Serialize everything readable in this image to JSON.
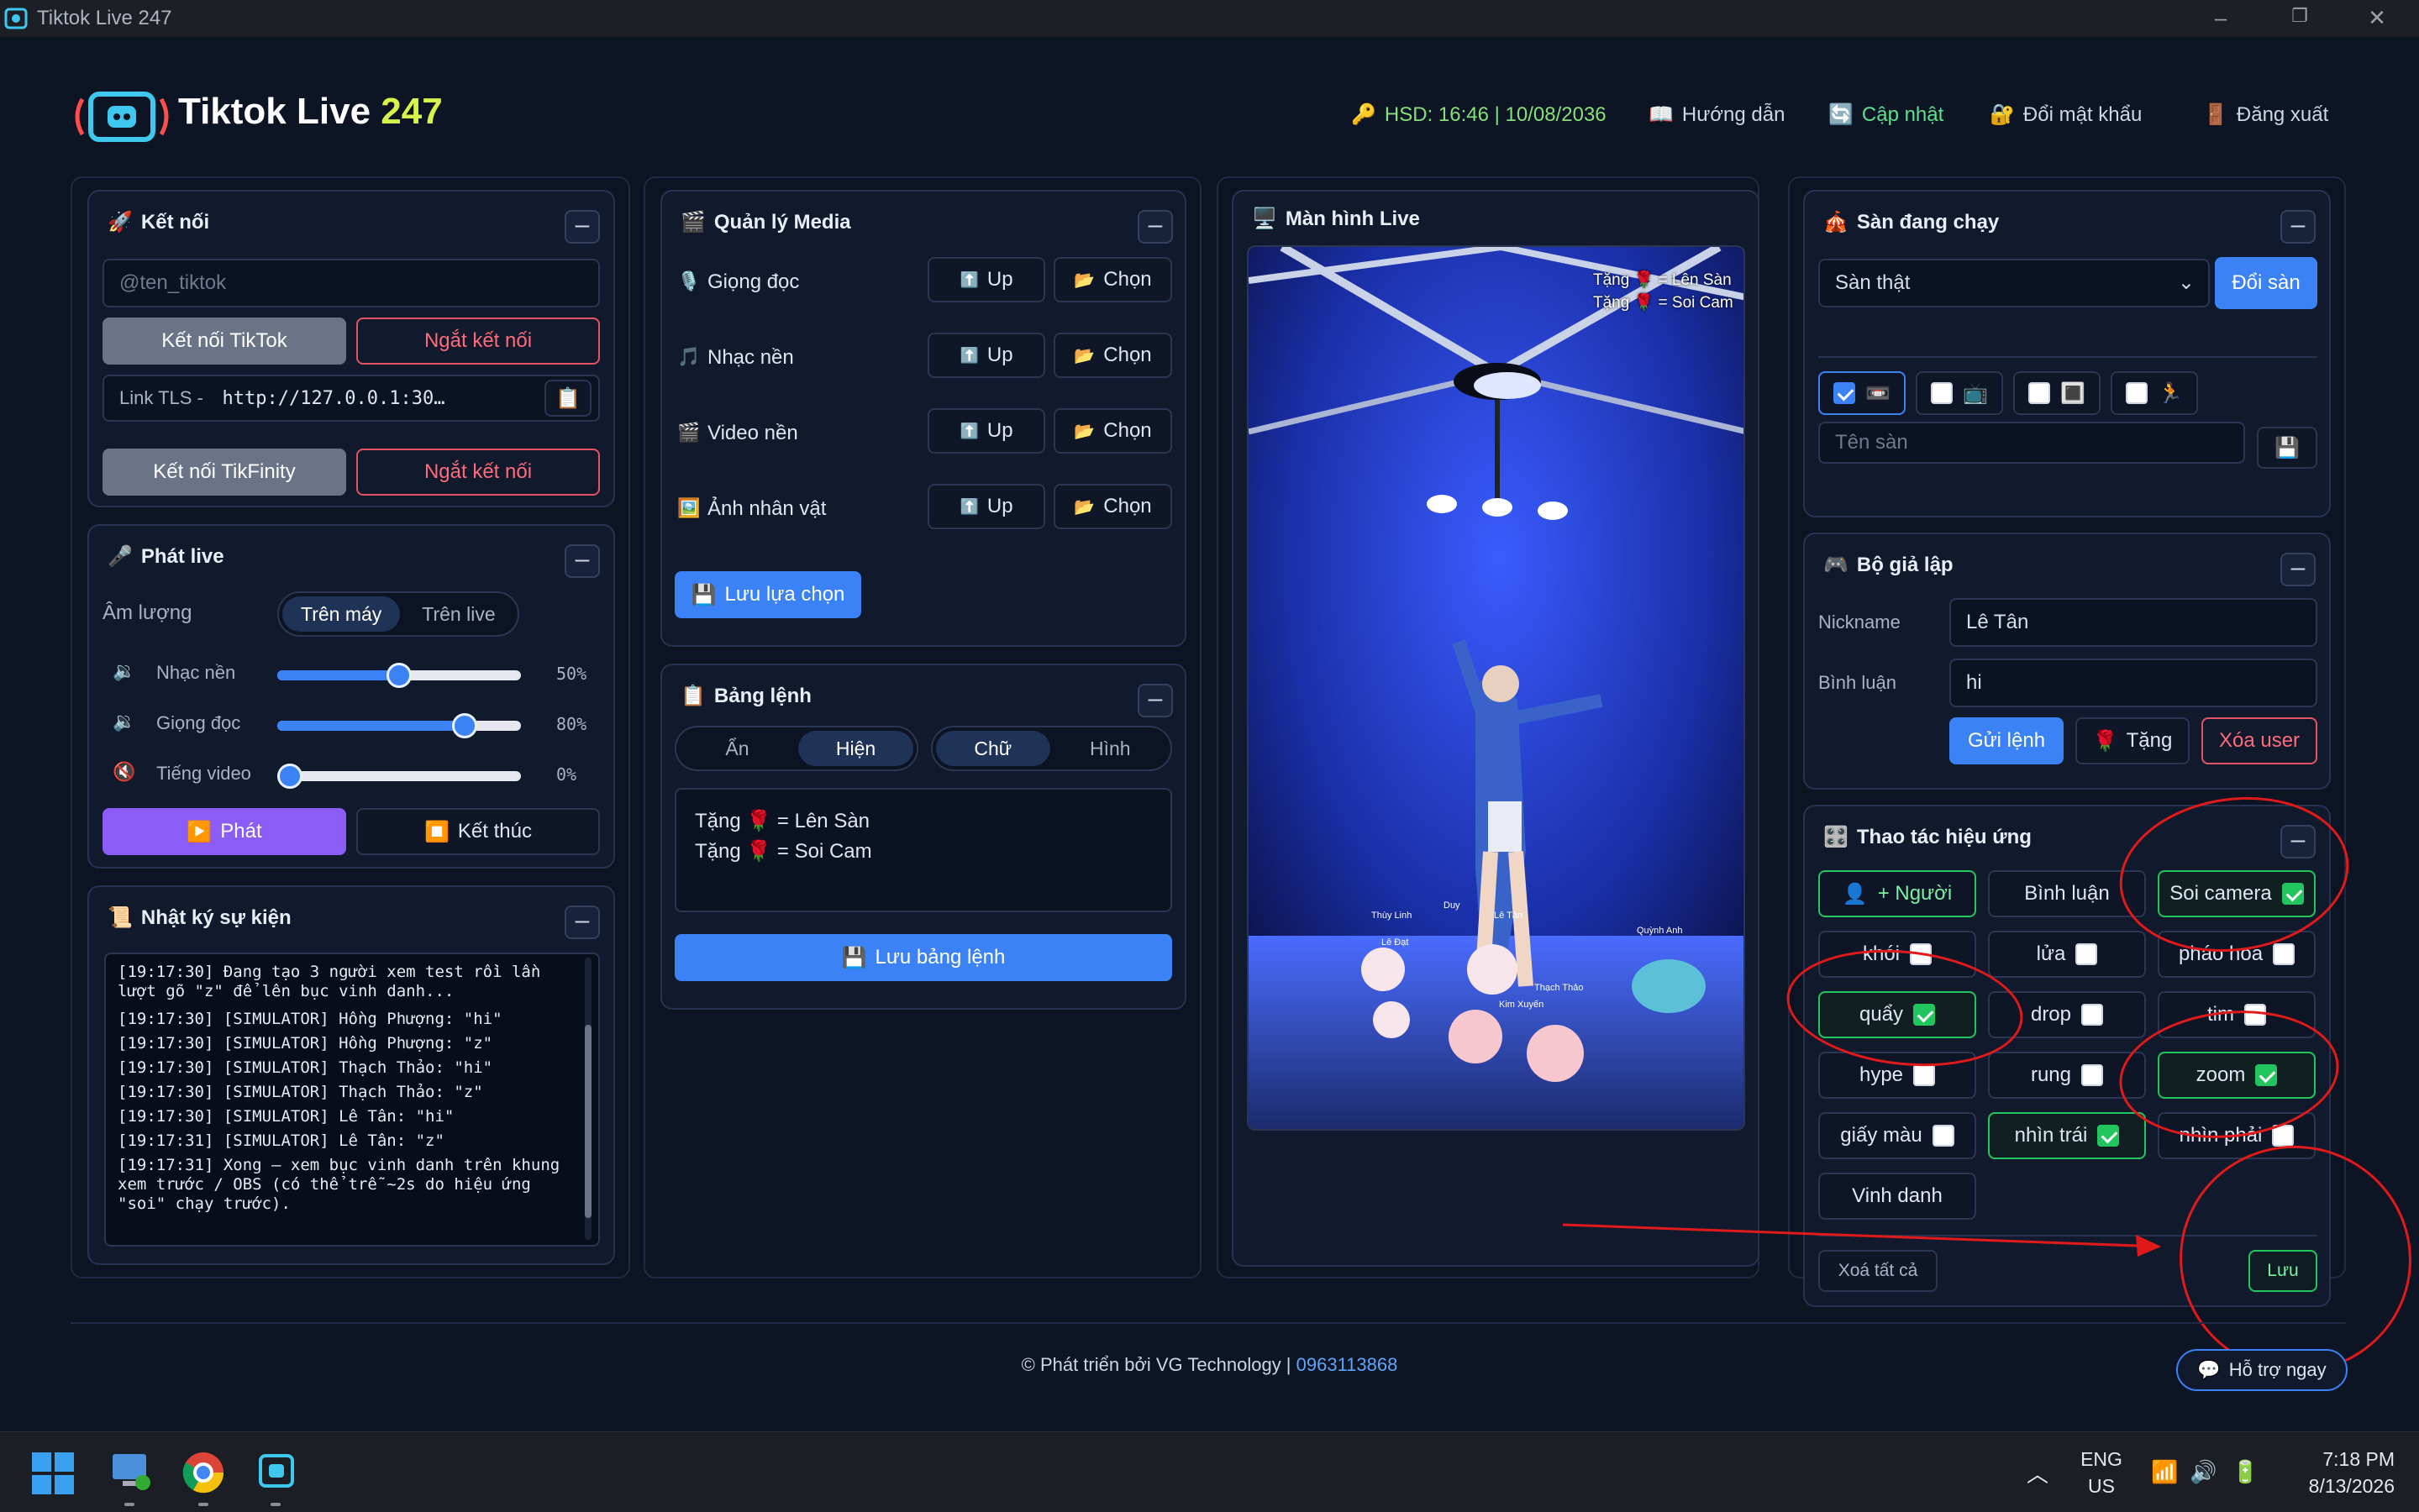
{
  "window": {
    "title": "Tiktok Live 247"
  },
  "brand": {
    "name": "Tiktok Live ",
    "accent": "247"
  },
  "header": {
    "hsd": "HSD: 16:46 | 10/08/2036",
    "guide": "Hướng dẫn",
    "update": "Cập nhật",
    "change_password": "Đổi mật khẩu",
    "logout": "Đăng xuất"
  },
  "connect": {
    "title": "Kết nối",
    "username_placeholder": "@ten_tiktok",
    "connect_tiktok": "Kết nối TikTok",
    "disconnect": "Ngắt kết nối",
    "link_label": "Link TLS -",
    "link_value": "http://127.0.0.1:30…",
    "connect_tikfinity": "Kết nối TikFinity",
    "disconnect2": "Ngắt kết nối"
  },
  "broadcast": {
    "title": "Phát live",
    "volume_label": "Âm lượng",
    "seg_machine": "Trên máy",
    "seg_live": "Trên live",
    "sliders": [
      {
        "label": "Nhạc nền",
        "value": 50,
        "text": "50%"
      },
      {
        "label": "Giọng đọc",
        "value": 80,
        "text": "80%"
      },
      {
        "label": "Tiếng video",
        "value": 0,
        "text": "0%"
      }
    ],
    "play": "Phát",
    "stop": "Kết thúc"
  },
  "log": {
    "title": "Nhật ký sự kiện",
    "lines": [
      "[19:17:30] Đang tạo 3 người xem test rồi lần lượt gõ \"z\" để lên bục vinh danh...",
      "[19:17:30] [SIMULATOR] Hồng Phượng: \"hi\"",
      "[19:17:30] [SIMULATOR] Hồng Phượng: \"z\"",
      "[19:17:30] [SIMULATOR] Thạch Thảo: \"hi\"",
      "[19:17:30] [SIMULATOR] Thạch Thảo: \"z\"",
      "[19:17:30] [SIMULATOR] Lê Tân: \"hi\"",
      "[19:17:31] [SIMULATOR] Lê Tân: \"z\"",
      "[19:17:31] Xong — xem bục vinh danh trên khung xem trước / OBS (có thể trễ ~2s do hiệu ứng \"soi\" chạy trước)."
    ]
  },
  "media": {
    "title": "Quản lý Media",
    "rows": [
      {
        "label": "Giọng đọc",
        "up": "Up",
        "choose": "Chọn"
      },
      {
        "label": "Nhạc nền",
        "up": "Up",
        "choose": "Chọn"
      },
      {
        "label": "Video nền",
        "up": "Up",
        "choose": "Chọn"
      },
      {
        "label": "Ảnh nhân vật",
        "up": "Up",
        "choose": "Chọn"
      }
    ],
    "save": "Lưu lựa chọn"
  },
  "commands": {
    "title": "Bảng lệnh",
    "seg1": [
      "Ẩn",
      "Hiện"
    ],
    "seg2": [
      "Chữ",
      "Hình"
    ],
    "lines": [
      "Tặng 🌹 = Lên Sàn",
      "Tặng 🌹 = Soi Cam"
    ],
    "save": "Lưu bảng lệnh"
  },
  "live": {
    "title": "Màn hình Live",
    "overlay": [
      "Tặng 🌹 = Lên Sàn",
      "Tặng 🌹 = Soi Cam"
    ],
    "names": [
      "Thùy Linh",
      "Lê Đạt",
      "Duy",
      "Lê Tân",
      "Quỳnh Anh",
      "Thạch Thảo",
      "Kim Xuyến"
    ]
  },
  "stage": {
    "title": "Sàn đang chạy",
    "select_value": "Sàn thật",
    "change": "Đổi sàn",
    "name_placeholder": "Tên sàn"
  },
  "simulator": {
    "title": "Bộ giả lập",
    "nickname_label": "Nickname",
    "nickname_value": "Lê Tân",
    "comment_label": "Bình luận",
    "comment_value": "hi",
    "send": "Gửi lệnh",
    "gift": "Tặng",
    "delete_user": "Xóa user"
  },
  "effects": {
    "title": "Thao tác hiệu ứng",
    "add_person": "+ Người",
    "comment": "Bình luận",
    "items": [
      {
        "label": "Soi camera",
        "checked": true
      },
      {
        "label": "khói",
        "checked": false
      },
      {
        "label": "lửa",
        "checked": false
      },
      {
        "label": "pháo hoa",
        "checked": false
      },
      {
        "label": "quẩy",
        "checked": true
      },
      {
        "label": "drop",
        "checked": false
      },
      {
        "label": "tim",
        "checked": false
      },
      {
        "label": "hype",
        "checked": false
      },
      {
        "label": "rung",
        "checked": false
      },
      {
        "label": "zoom",
        "checked": true
      },
      {
        "label": "giấy màu",
        "checked": false
      },
      {
        "label": "nhìn trái",
        "checked": true
      },
      {
        "label": "nhìn phải",
        "checked": false
      }
    ],
    "honor": "Vinh danh",
    "clear": "Xoá tất cả",
    "save": "Lưu"
  },
  "footer": {
    "text": "© Phát triển bởi VG Technology | ",
    "phone": "0963113868",
    "support": "Hỗ trợ ngay"
  },
  "taskbar": {
    "lang1": "ENG",
    "lang2": "US",
    "time": "7:18 PM",
    "date": "8/13/2026"
  },
  "colors": {
    "bg": "#0d1424",
    "card": "#111a2d",
    "blue": "#3b82f6",
    "green": "#22c55e",
    "red": "#e05566",
    "purple": "#8b5cf6",
    "accent": "#d7f24a"
  }
}
